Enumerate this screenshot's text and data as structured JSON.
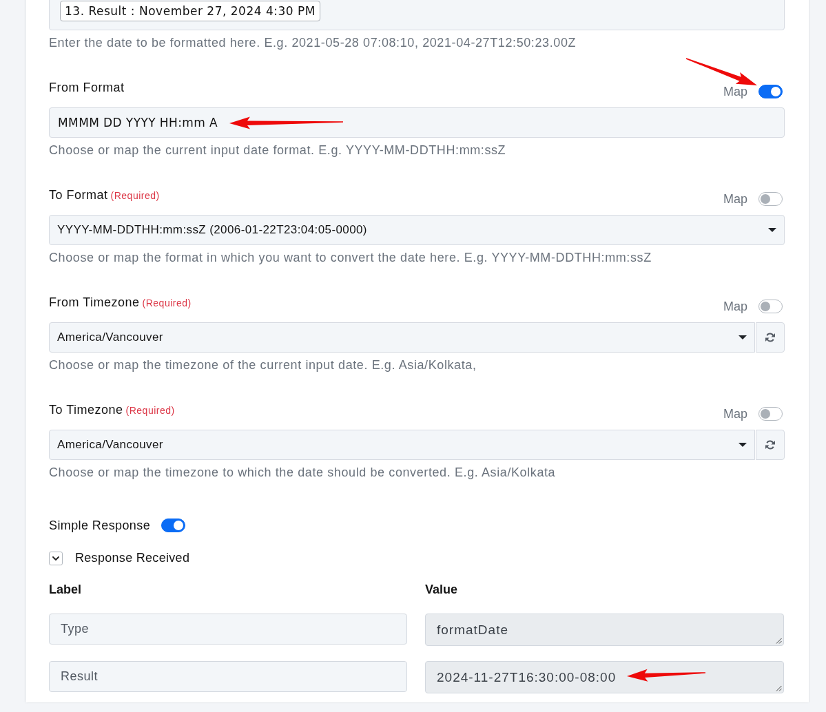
{
  "date_field": {
    "token": "13. Result : November 27, 2024 4:30 PM",
    "help": "Enter the date to be formatted here. E.g. 2021-05-28 07:08:10, 2021-04-27T12:50:23.00Z"
  },
  "fields": [
    {
      "kind": "text",
      "label": "From Format",
      "map": {
        "label": "Map",
        "on": true
      },
      "value": "MMMM DD YYYY HH:mm A",
      "help": "Choose or map the current input date format. E.g. YYYY-MM-DDTHH:mm:ssZ"
    },
    {
      "kind": "dropdown",
      "label": "To Format",
      "required_note": "(Required)",
      "map": {
        "label": "Map",
        "on": false
      },
      "value": "YYYY-MM-DDTHH:mm:ssZ (2006-01-22T23:04:05-0000)",
      "help": "Choose or map the format in which you want to convert the date here. E.g. YYYY-MM-DDTHH:mm:ssZ"
    },
    {
      "kind": "dropdown",
      "label": "From Timezone",
      "required_note": "(Required)",
      "map": {
        "label": "Map",
        "on": false
      },
      "value": "America/Vancouver",
      "refresh": true,
      "help": "Choose or map the timezone of the current input date. E.g. Asia/Kolkata,"
    },
    {
      "kind": "dropdown",
      "label": "To Timezone",
      "required_note": "(Required)",
      "map": {
        "label": "Map",
        "on": false
      },
      "value": "America/Vancouver",
      "refresh": true,
      "help": "Choose or map the timezone to which the date should be converted. E.g. Asia/Kolkata"
    }
  ],
  "simple_response": {
    "label": "Simple Response",
    "on": true
  },
  "response": {
    "title": "Response Received",
    "expanded": true,
    "columns": [
      "Label",
      "Value"
    ],
    "rows": [
      {
        "label": "Type",
        "value": "formatDate"
      },
      {
        "label": "Result",
        "value": "2024-11-27T16:30:00-08:00"
      }
    ]
  }
}
